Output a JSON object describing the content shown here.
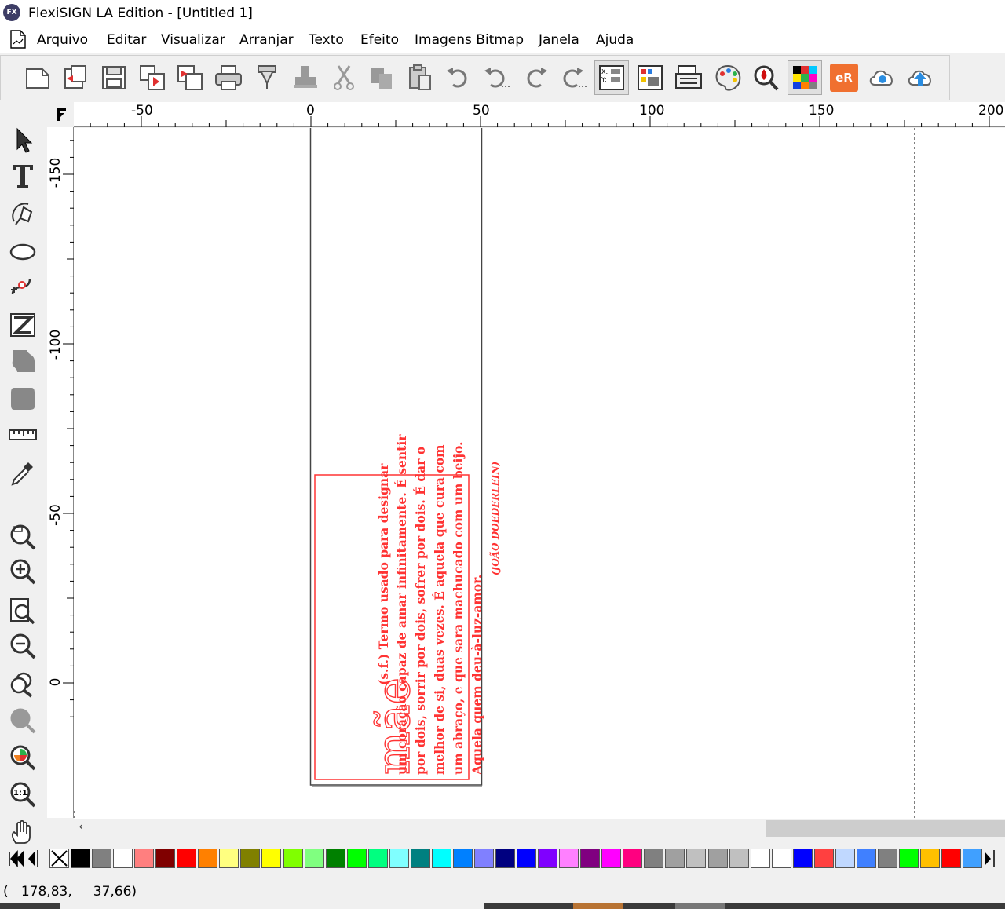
{
  "window": {
    "title": "FlexiSIGN LA Edition - [Untitled 1]",
    "app_icon_text": "FX"
  },
  "menu": [
    "Arquivo",
    "Editar",
    "Visualizar",
    "Arranjar",
    "Texto",
    "Efeito",
    "Imagens Bitmap",
    "Janela",
    "Ajuda"
  ],
  "toolbar": {
    "icons": [
      "new-document-icon",
      "open-icon",
      "save-icon",
      "import-icon",
      "export-icon",
      "print-icon",
      "cut-output-icon",
      "stamp-icon",
      "cut-icon",
      "copy-icon",
      "paste-icon",
      "undo-icon",
      "undo-list-icon",
      "redo-icon",
      "redo-list-icon",
      "position-size-icon",
      "color-table-icon",
      "production-manager-icon",
      "color-palette-icon",
      "color-picker-zoom-icon",
      "color-separation-icon",
      "enroute-icon",
      "cloud-connect-icon",
      "cloud-upload-icon"
    ],
    "enroute_label": "eR"
  },
  "toolbox": {
    "icons": [
      "select-arrow-icon",
      "text-tool-icon",
      "bezier-pen-icon",
      "ellipse-tool-icon",
      "node-edit-icon",
      "distort-tool-icon",
      "blob-shape-icon",
      "shape-tool-icon",
      "measure-ruler-icon",
      "eyedropper-icon",
      "zoom-tool-icon",
      "zoom-in-icon",
      "zoom-page-icon",
      "zoom-out-icon",
      "zoom-all-icon",
      "zoom-previous-icon",
      "zoom-selection-icon",
      "zoom-actual-icon",
      "pan-hand-icon"
    ],
    "zoom_actual_label": "1:1"
  },
  "ruler": {
    "top_labels": [
      "-50",
      "0",
      "50",
      "100",
      "150",
      "200"
    ],
    "left_labels": [
      "-150",
      "-100",
      "-50",
      "0"
    ]
  },
  "document": {
    "title_word": "mãe",
    "definition": "(s.f.) Termo usado para designar um coração capaz de amar infinitamente. É sentir por dois, sorrir por dois, sofrer por dois. É dar o melhor de si, duas vezes. É aquela que cura com um abraço, e que sara machucado com um beijo. Aquela quem deu-à-luz-amor.",
    "lines": [
      "(s.f.) Termo usado para designar",
      "um coração capaz de amar infinitamente. É sentir",
      "por dois, sorrir por dois, sofrer por dois. É dar o",
      "melhor de si, duas vezes. É aquela que cura com",
      "um abraço, e que sara machucado com um beijo.",
      "Aquela quem deu-à-luz-amor."
    ],
    "author": "(JOÃO DOEDERLEIN)",
    "text_color": "#ff3333"
  },
  "palette": {
    "colors": [
      "#000000",
      "#808080",
      "#ffffff",
      "#ff7f7f",
      "#800000",
      "#ff0000",
      "#ff8000",
      "#ffff80",
      "#808000",
      "#ffff00",
      "#80ff00",
      "#80ff80",
      "#008000",
      "#00ff00",
      "#00ff80",
      "#80ffff",
      "#008080",
      "#00ffff",
      "#0080ff",
      "#8080ff",
      "#000080",
      "#0000ff",
      "#8000ff",
      "#ff80ff",
      "#800080",
      "#ff00ff",
      "#ff0080",
      "#808080",
      "#a0a0a0",
      "#c0c0c0",
      "#a0a0a0",
      "#c0c0c0",
      "#ffffff",
      "#ffffff",
      "#0000ff",
      "#ff4040",
      "#c0d8ff",
      "#4080ff",
      "#808080",
      "#00ff00",
      "#ffc000",
      "#ff0000",
      "#40a0ff"
    ]
  },
  "status": {
    "coordinates": "(   178,83,     37,66)"
  }
}
